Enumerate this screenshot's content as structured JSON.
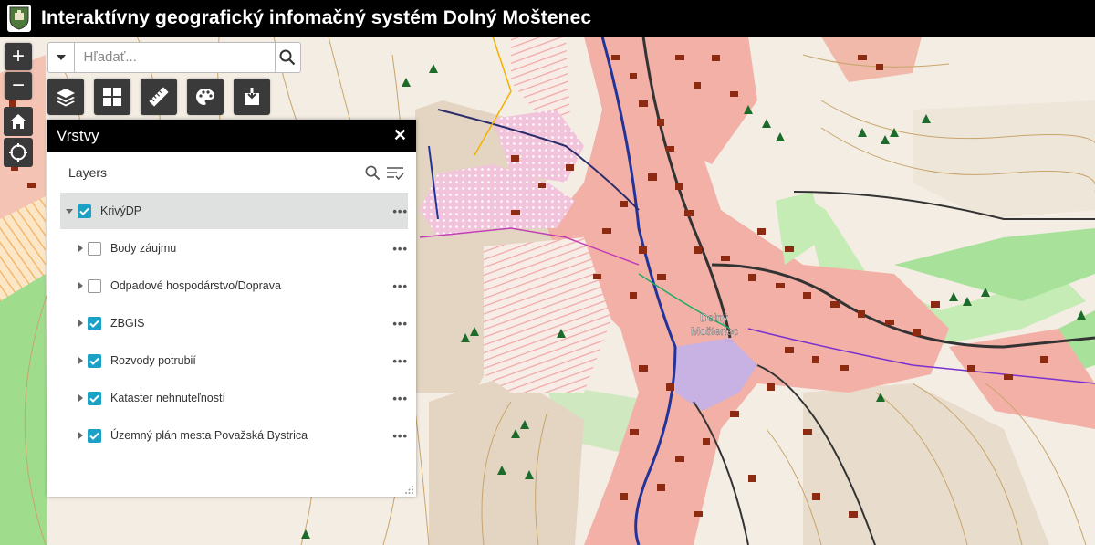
{
  "header": {
    "title": "Interaktívny geografický infomačný systém Dolný Moštenec",
    "logo_icon": "coat-of-arms-icon"
  },
  "map_controls": {
    "zoom_in": "+",
    "zoom_out": "−",
    "home_icon": "home-icon",
    "locate_icon": "locate-icon"
  },
  "search": {
    "placeholder": "Hľadať...",
    "value": ""
  },
  "toolbar": {
    "icons": [
      "layers-icon",
      "basemap-gallery-icon",
      "measure-ruler-icon",
      "draw-palette-icon",
      "print-export-icon"
    ]
  },
  "panel": {
    "title": "Vrstvy",
    "close": "✕",
    "layers_title": "Layers",
    "layers": [
      {
        "label": "KrivýDP",
        "checked": true
      },
      {
        "label": "Body záujmu",
        "checked": false
      },
      {
        "label": "Odpadové hospodárstvo/Doprava",
        "checked": false
      },
      {
        "label": "ZBGIS",
        "checked": true
      },
      {
        "label": "Rozvody potrubií",
        "checked": true
      },
      {
        "label": "Kataster nehnuteľností",
        "checked": true
      },
      {
        "label": "Územný plán mesta Považská Bystrica",
        "checked": true
      }
    ],
    "more": "•••"
  },
  "map": {
    "place_label_1": "Dolný",
    "place_label_2": "Moštenec",
    "accent": "#1ba1c6"
  }
}
